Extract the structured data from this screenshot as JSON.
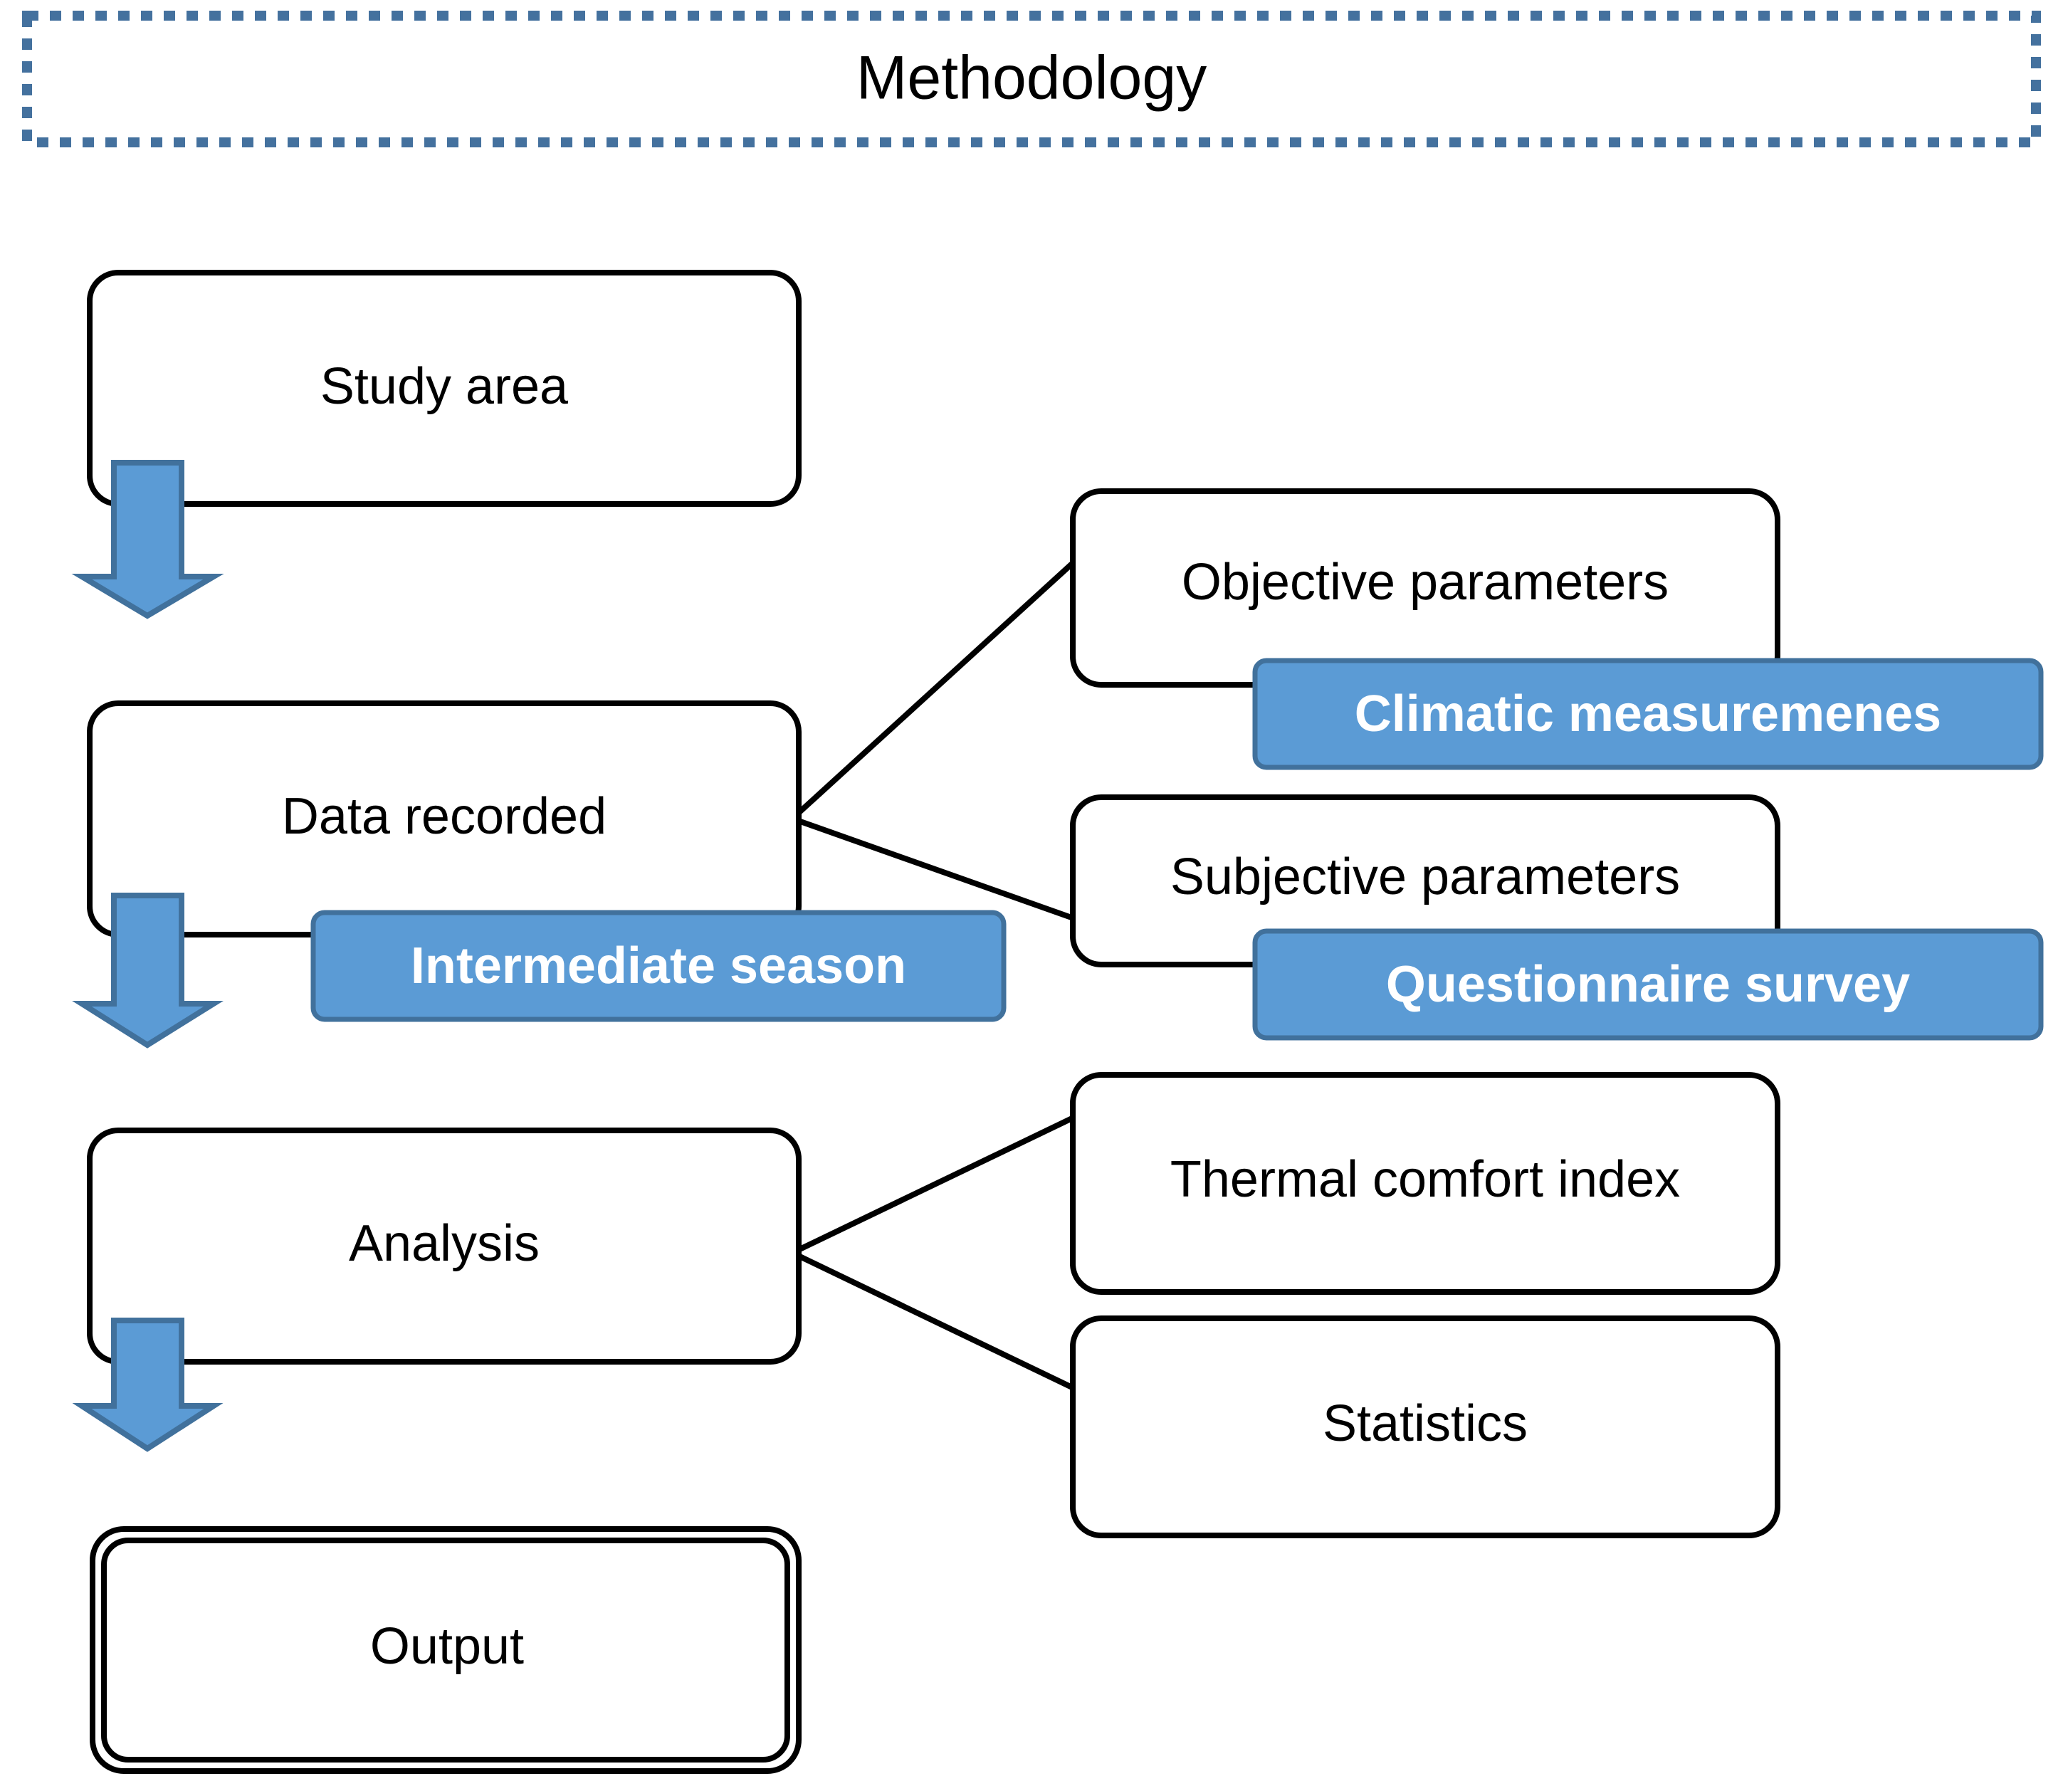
{
  "diagram": {
    "title": "Methodology",
    "colors": {
      "accent_blue": "#5B9BD5",
      "accent_blue_dark": "#41719C",
      "title_border": "#44719E",
      "node_border": "#000000",
      "node_fill": "#FFFFFF",
      "blue_label_text": "#FFFFFF"
    },
    "nodes": {
      "study_area": "Study area",
      "data_recorded": "Data recorded",
      "analysis": "Analysis",
      "output": "Output",
      "objective_parameters": "Objective parameters",
      "subjective_parameters": "Subjective parameters",
      "thermal_comfort_index": "Thermal comfort index",
      "statistics": "Statistics"
    },
    "blue_labels": {
      "intermediate_season": "Intermediate season",
      "climatic_measurements": "Climatic measuremenes",
      "questionnaire_survey": "Questionnaire survey"
    },
    "flow": {
      "arrow_1": "Study area to Data recorded",
      "arrow_2": "Data recorded to Analysis",
      "arrow_3": "Analysis to Output",
      "branch_1": "Data recorded branches to Objective parameters and Subjective parameters",
      "branch_2": "Analysis branches to Thermal comfort index and Statistics"
    }
  }
}
